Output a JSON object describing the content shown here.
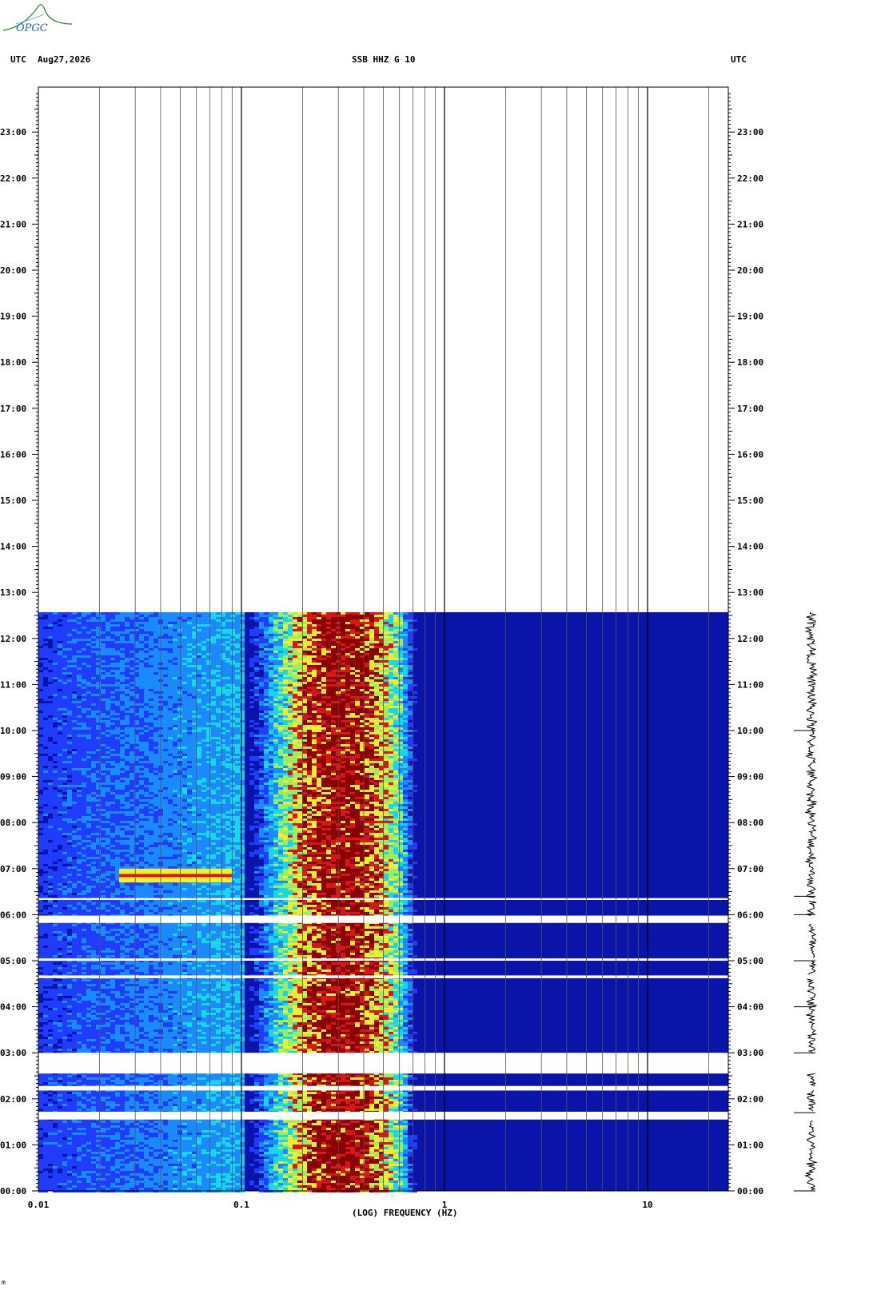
{
  "header": {
    "left_tz": "UTC",
    "date": "Aug27,2026",
    "title": "SSB HHZ G 10",
    "right_tz": "UTC"
  },
  "logo": {
    "text": "OPGC"
  },
  "colors": {
    "background_blue": "#0a14a8",
    "low_blue": "#1f3cff",
    "mid_cyan": "#18d8f0",
    "yellow": "#f0f030",
    "red": "#d81818",
    "dark_red": "#8b0000",
    "grid": "#000000"
  },
  "chart_data": {
    "type": "heatmap",
    "title": "SSB HHZ G 10",
    "xlabel": "(LOG) FREQUENCY (HZ)",
    "ylabel": "UTC",
    "x_scale": "log",
    "xlim": [
      0.01,
      25
    ],
    "x_ticks": [
      "0.01",
      "0.1",
      "1",
      "10"
    ],
    "ylim_hours": [
      0,
      24
    ],
    "y_ticks": [
      "00:00",
      "01:00",
      "02:00",
      "03:00",
      "04:00",
      "05:00",
      "06:00",
      "07:00",
      "08:00",
      "09:00",
      "10:00",
      "11:00",
      "12:00",
      "13:00",
      "14:00",
      "15:00",
      "16:00",
      "17:00",
      "18:00",
      "19:00",
      "20:00",
      "21:00",
      "22:00",
      "23:00"
    ],
    "data_end_hour": 12.57,
    "gaps_hours": [
      [
        1.55,
        1.72
      ],
      [
        2.18,
        2.28
      ],
      [
        2.55,
        3.0
      ],
      [
        4.62,
        4.68
      ],
      [
        5.0,
        5.05
      ],
      [
        5.82,
        5.98
      ],
      [
        6.32,
        6.36
      ]
    ],
    "energy_peak_hz": 0.3,
    "energy_band_hz": [
      0.1,
      0.6
    ],
    "low_freq_event": {
      "hours": [
        6.7,
        7.0
      ],
      "freq_hz": [
        0.025,
        0.09
      ]
    }
  },
  "bottom_mark": "m"
}
